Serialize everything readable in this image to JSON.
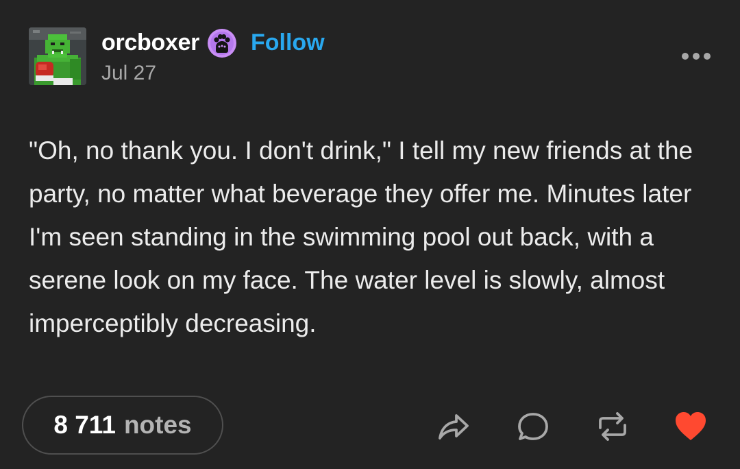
{
  "post": {
    "author": {
      "username": "orcboxer",
      "avatar_icon": "orc-boxer-avatar",
      "badge_icon": "paw-badge-icon",
      "follow_label": "Follow",
      "date": "Jul 27"
    },
    "menu_icon": "more-dots-icon",
    "body": "\"Oh, no thank you. I don't drink,\" I tell my new friends at the party, no matter what beverage they offer me. Minutes later I'm seen standing in the swimming pool out back, with a serene look on my face. The water level is slowly, almost imperceptibly decreasing.",
    "notes": {
      "count": "8 711",
      "label": "notes"
    },
    "actions": [
      {
        "icon": "share-icon"
      },
      {
        "icon": "reply-icon"
      },
      {
        "icon": "reblog-icon"
      },
      {
        "icon": "heart-icon"
      }
    ]
  },
  "colors": {
    "background": "#232323",
    "accent_blue": "#29a8ef",
    "heart_red": "#ff4930",
    "badge_purple": "#c98ef5"
  }
}
